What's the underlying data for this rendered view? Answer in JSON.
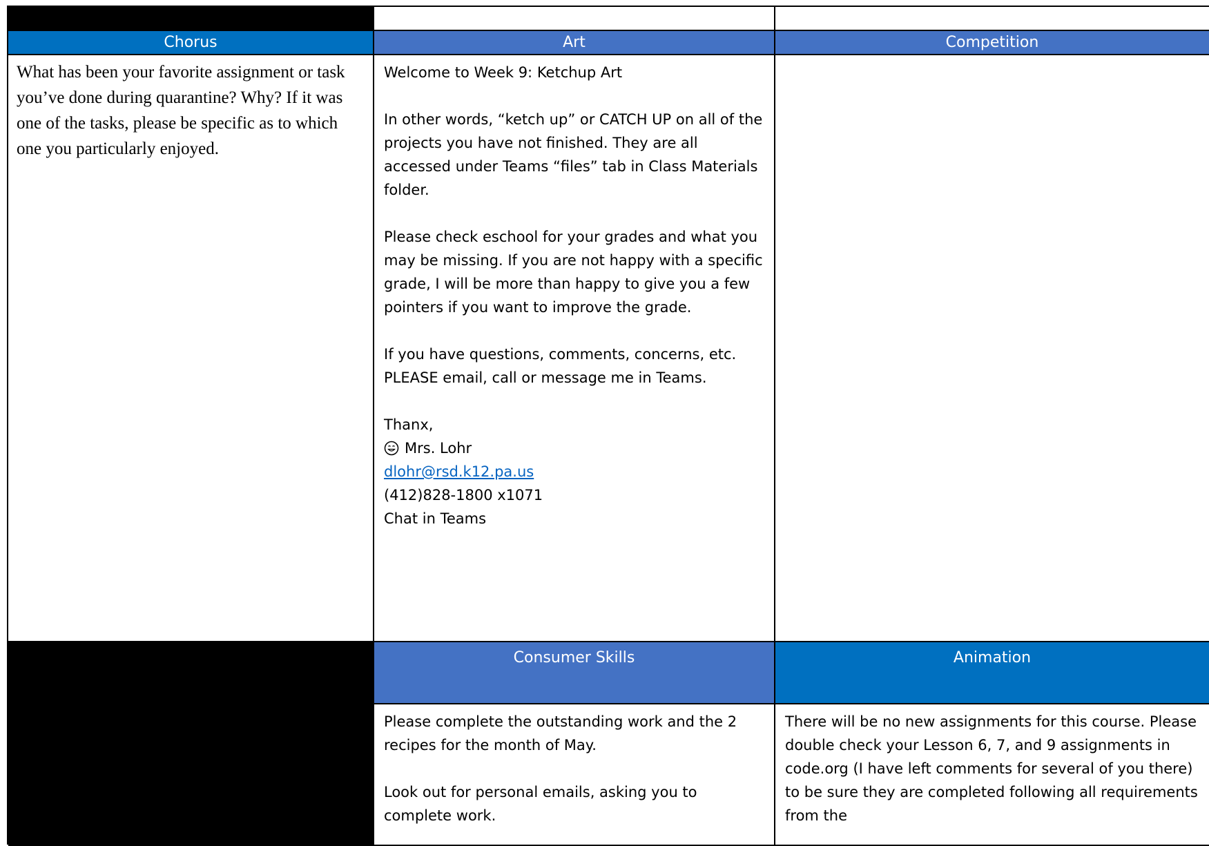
{
  "headers": {
    "chorus": "Chorus",
    "art": "Art",
    "competition": "Competition",
    "consumer_skills": "Consumer Skills",
    "animation": "Animation"
  },
  "chorus": {
    "text": "What has been your favorite assignment or task you’ve done during quarantine?  Why?  If it was one of the tasks, please be specific as to which one you particularly enjoyed."
  },
  "art": {
    "welcome": "Welcome to Week 9: Ketchup Art",
    "p1": "In other words, “ketch up” or CATCH UP on all of the projects you have not finished. They are all accessed under Teams “files” tab in Class Materials folder.",
    "p2": "Please check eschool for your grades and what you may be missing. If you are not happy with a specific grade, I will be more than happy to give you a few pointers if you want to improve the grade.",
    "p3": "If you have questions, comments, concerns, etc. PLEASE email, call or message me in Teams.",
    "thanks": "Thanx,",
    "signature": "Mrs. Lohr",
    "email": "dlohr@rsd.k12.pa.us",
    "phone": "(412)828-1800 x1071",
    "chat": "Chat in Teams"
  },
  "consumer_skills": {
    "p1": "Please complete the outstanding work and the 2 recipes for the month of May.",
    "p2": "Look out for personal emails, asking you to complete work."
  },
  "animation": {
    "text": "There will be no new assignments for this course. Please double check your Lesson 6, 7, and 9 assignments in code.org (I have left comments for several of you there) to be sure they are completed following all requirements from the"
  },
  "colors": {
    "header_dark_blue": "#0070c0",
    "header_blue": "#4472c4",
    "link_blue": "#0563c1",
    "header_text": "#ffffff"
  },
  "icons": {
    "smiley": "smiling-face-icon"
  }
}
